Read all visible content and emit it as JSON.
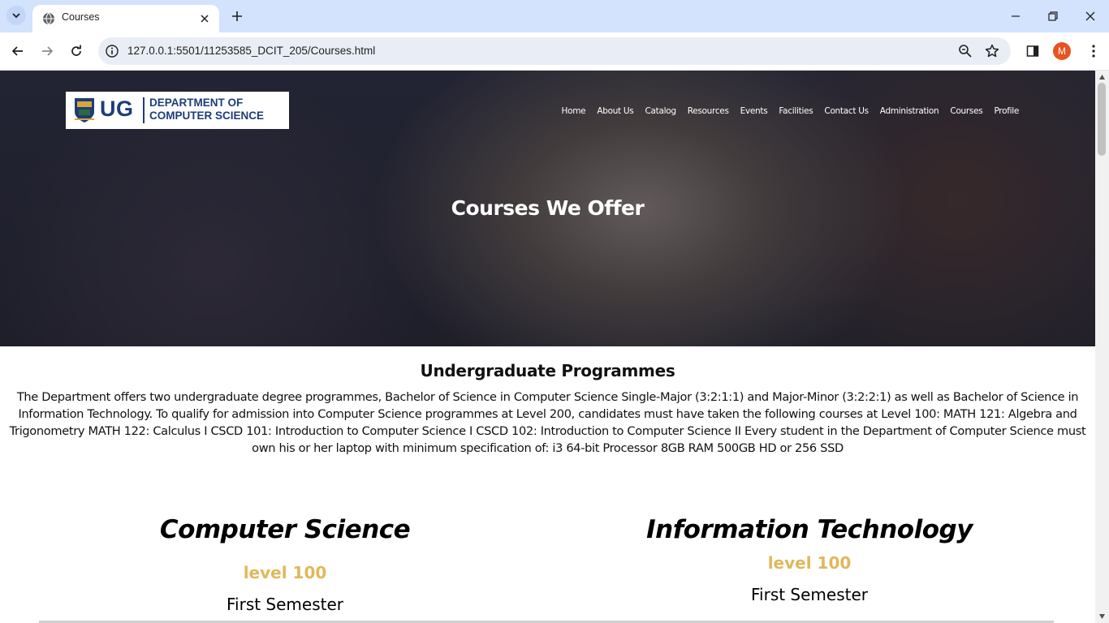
{
  "browser": {
    "tab_title": "Courses",
    "url": "127.0.0.1:5501/11253585_DCIT_205/Courses.html",
    "profile_initial": "M"
  },
  "logo": {
    "ug": "UG",
    "line1": "DEPARTMENT OF",
    "line2": "COMPUTER SCIENCE"
  },
  "nav": {
    "items": [
      "Home",
      "About Us",
      "Catalog",
      "Resources",
      "Events",
      "Facilities",
      "Contact Us",
      "Administration",
      "Courses",
      "Profile"
    ]
  },
  "hero": {
    "title": "Courses We Offer"
  },
  "undergrad": {
    "title": "Undergraduate Programmes",
    "body": "The Department offers two undergraduate degree programmes, Bachelor of Science in Computer Science Single-Major (3:2:1:1) and Major-Minor (3:2:2:1) as well as Bachelor of Science in Information Technology. To qualify for admission into Computer Science programmes at Level 200, candidates must have taken the following courses at Level 100: MATH 121: Algebra and Trigonometry MATH 122: Calculus I CSCD 101: Introduction to Computer Science I CSCD 102: Introduction to Computer Science II Every student in the Department of Computer Science must own his or her laptop with minimum specification of: i3 64-bit Processor 8GB RAM 500GB HD or 256 SSD"
  },
  "programmes": {
    "cs": {
      "title": "Computer Science",
      "level": "level 100",
      "semester": "First Semester"
    },
    "it": {
      "title": "Information Technology",
      "level": "level 100",
      "semester": "First Semester"
    }
  },
  "colors": {
    "level_accent": "#e0b85a",
    "brand_blue": "#1d3d7a"
  }
}
